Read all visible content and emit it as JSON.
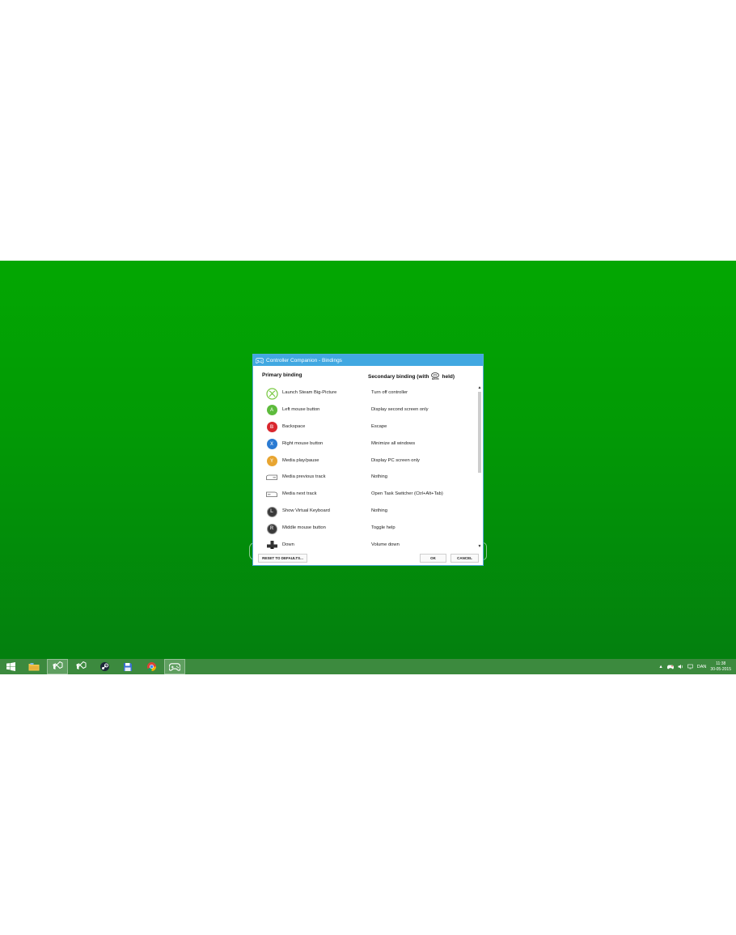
{
  "dialog": {
    "title": "Controller Companion - Bindings",
    "header_primary": "Primary binding",
    "header_secondary_prefix": "Secondary binding (with",
    "header_secondary_badge": "BACK",
    "header_secondary_suffix": "held)",
    "rows": [
      {
        "button": "xbox-guide",
        "label": "",
        "primary": "Launch Steam Big-Picture",
        "secondary": "Turn off controller",
        "color": "#7ac943"
      },
      {
        "button": "a",
        "label": "A",
        "primary": "Left mouse button",
        "secondary": "Display second screen only",
        "color": "#5dbb3c"
      },
      {
        "button": "b",
        "label": "B",
        "primary": "Backspace",
        "secondary": "Escape",
        "color": "#d9272e"
      },
      {
        "button": "x",
        "label": "X",
        "primary": "Right mouse button",
        "secondary": "Minimize all windows",
        "color": "#2b7bd3"
      },
      {
        "button": "y",
        "label": "Y",
        "primary": "Media play/pause",
        "secondary": "Display PC screen only",
        "color": "#e8a531"
      },
      {
        "button": "left-bumper",
        "label": "",
        "primary": "Media previous track",
        "secondary": "Nothing",
        "color": "#666666"
      },
      {
        "button": "right-bumper",
        "label": "",
        "primary": "Media next track",
        "secondary": "Open Task Switcher (Ctrl+Alt+Tab)",
        "color": "#666666"
      },
      {
        "button": "left-stick",
        "label": "L",
        "primary": "Show Virtual Keyboard",
        "secondary": "Nothing",
        "color": "#3a3a3a"
      },
      {
        "button": "right-stick",
        "label": "R",
        "primary": "Middle mouse button",
        "secondary": "Toggle help",
        "color": "#3a3a3a"
      },
      {
        "button": "dpad-down",
        "label": "",
        "primary": "Down",
        "secondary": "Volume down",
        "color": "#333333"
      }
    ],
    "buttons": {
      "reset": "RESET TO DEFAULTS...",
      "ok": "OK",
      "cancel": "CANCEL"
    }
  },
  "taskbar": {
    "apps": [
      "start",
      "file-explorer",
      "visual-studio",
      "visual-studio-preview",
      "steam",
      "save-disk",
      "chrome",
      "controller-companion"
    ],
    "tray_language": "DAN",
    "clock_time": "11:38",
    "clock_date": "30-05-2015"
  },
  "colors": {
    "accent": "#41a8e1",
    "desktop": "#03a702",
    "taskbar": "#3c8a3e"
  }
}
